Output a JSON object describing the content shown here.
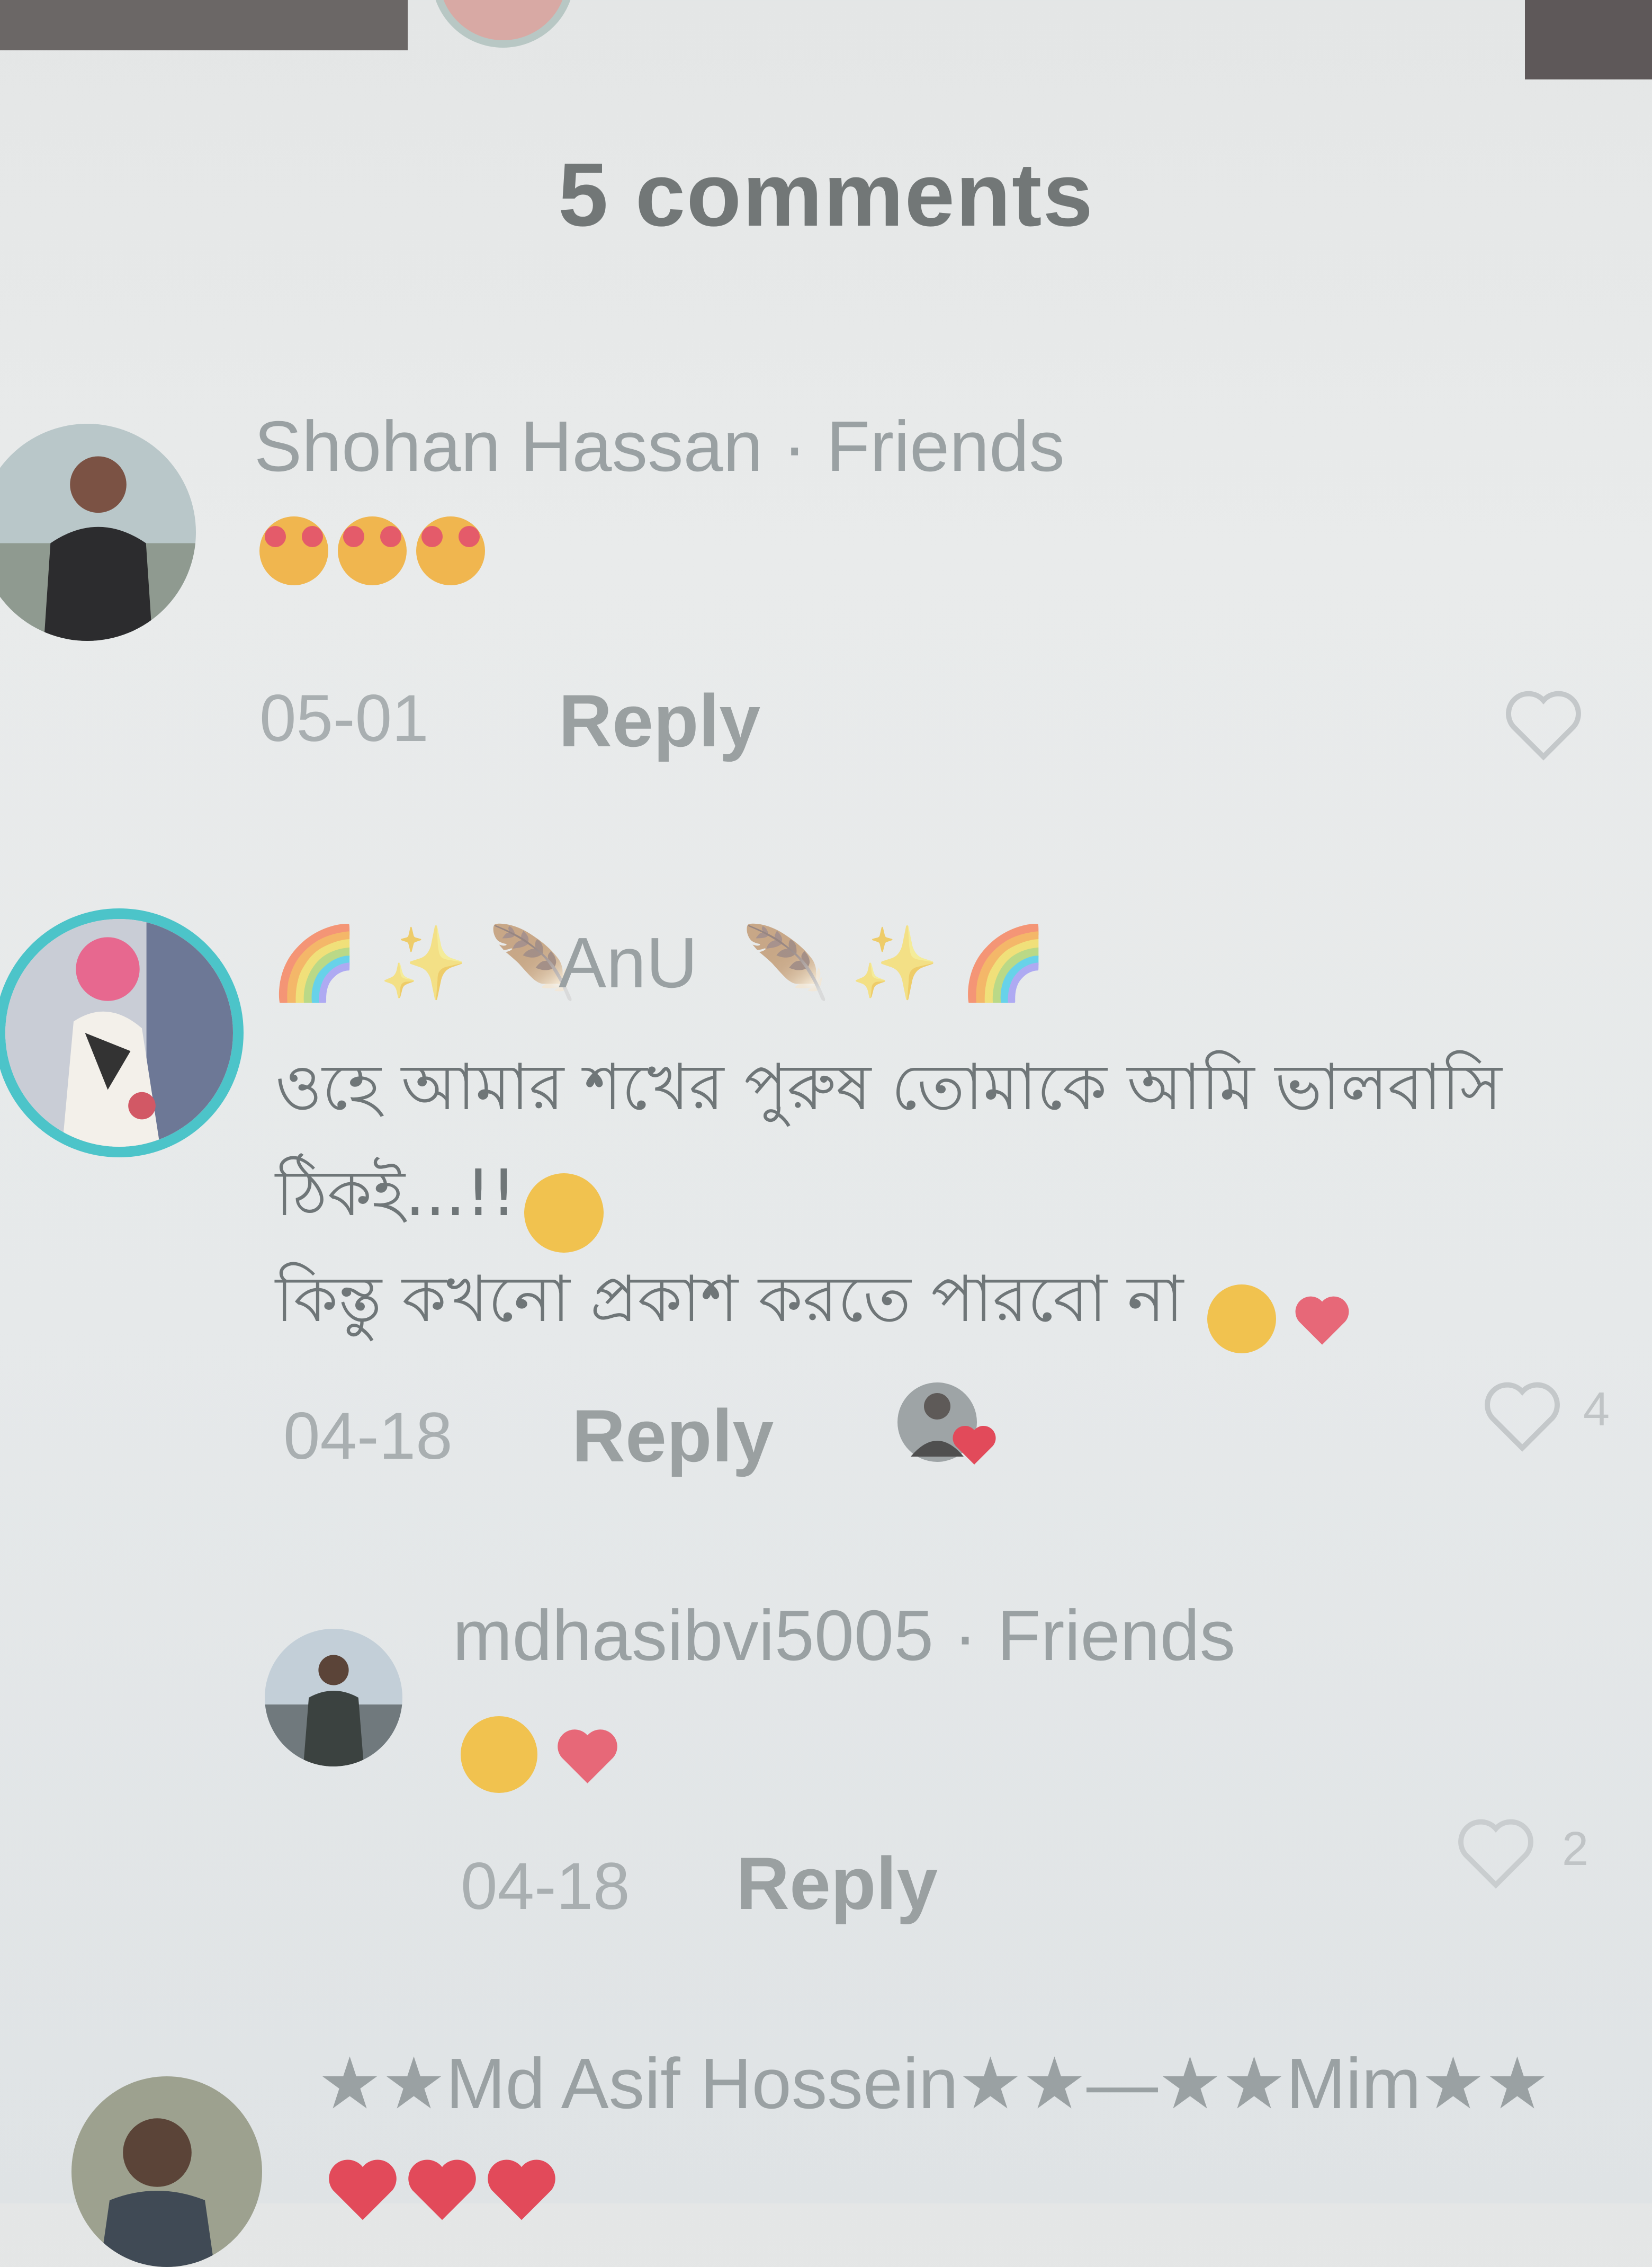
{
  "header": {
    "title": "5 comments"
  },
  "comments": [
    {
      "name": "Shohan Hassan · Friends",
      "emojis": [
        "smiling-face-with-hearts",
        "smiling-face-with-hearts",
        "smiling-face-with-hearts"
      ],
      "date": "05-01",
      "reply": "Reply"
    },
    {
      "name_prefix": "🌈 ✨ 🪶",
      "name": "AnU",
      "name_suffix": "🪶 ✨ 🌈",
      "line1": "ওহে আমার শখের পুরুষ তোমাকে আমি ভালবাসি",
      "line2": "ঠিকই...!!",
      "line3": "কিন্তু কখনো প্রকাশ করতে পারবো না",
      "date": "04-18",
      "reply": "Reply",
      "like_count": "4"
    },
    {
      "name": "mdhasibvi5005 · Friends",
      "date": "04-18",
      "reply": "Reply",
      "like_count": "2"
    },
    {
      "name": "★★Md Asif Hossein★★—★★Mim★★"
    }
  ],
  "colors": {
    "accent_ring": "#4cc4c9",
    "heart": "#e24a5a"
  }
}
